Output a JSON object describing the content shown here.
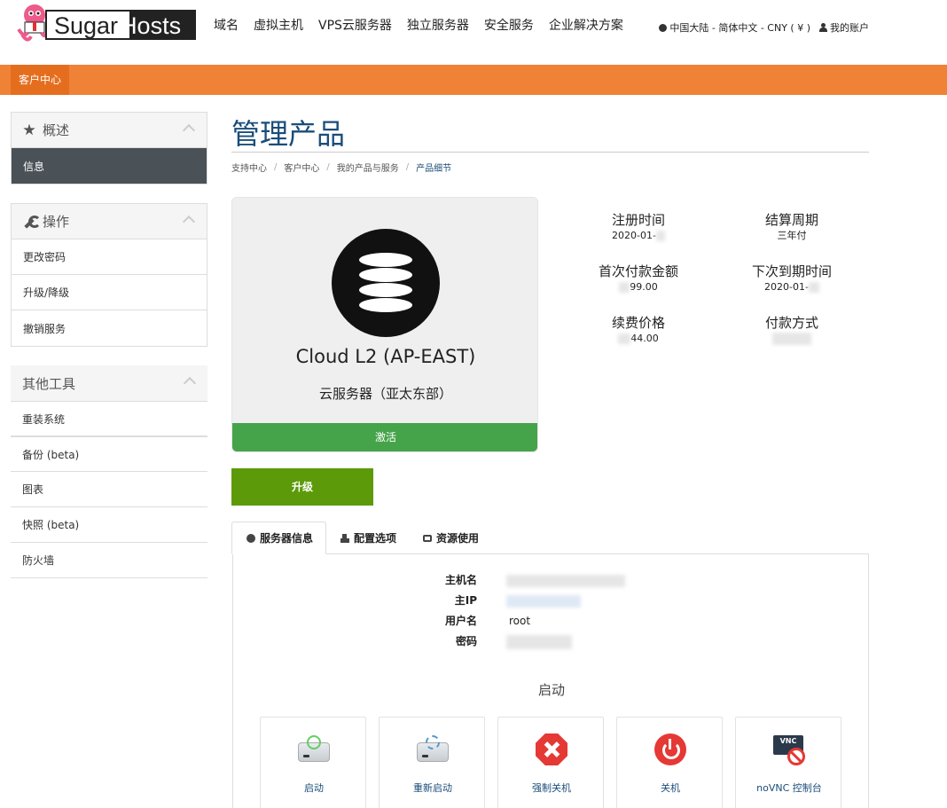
{
  "header": {
    "logo": {
      "sugar": "Sugar",
      "hosts": "Hosts"
    },
    "nav": [
      "域名",
      "虚拟主机",
      "VPS云服务器",
      "独立服务器",
      "安全服务",
      "企业解决方案"
    ],
    "locale": "中国大陆 - 简体中文 - CNY ( ¥ )",
    "account": "我的账户"
  },
  "subnav": {
    "tab": "客户中心"
  },
  "sidebar": {
    "overview": {
      "title": "概述",
      "items": [
        "信息"
      ]
    },
    "actions": {
      "title": "操作",
      "items": [
        "更改密码",
        "升级/降级",
        "撤销服务"
      ]
    },
    "tools": {
      "title": "其他工具",
      "items": [
        "重装系统",
        "备份 (beta)",
        "图表",
        "快照 (beta)",
        "防火墙"
      ]
    }
  },
  "main": {
    "title": "管理产品",
    "breadcrumb": [
      "支持中心",
      "客户中心",
      "我的产品与服务",
      "产品细节"
    ],
    "product": {
      "name": "Cloud L2 (AP-EAST)",
      "sub": "云服务器（亚太东部）",
      "status": "激活"
    },
    "info": {
      "reg_label": "注册时间",
      "reg_value": "2020-01-",
      "cycle_label": "结算周期",
      "cycle_value": "三年付",
      "first_label": "首次付款金额",
      "first_value": "99.00",
      "next_label": "下次到期时间",
      "next_value": "2020-01-",
      "renew_label": "续费价格",
      "renew_value": "44.00",
      "pay_label": "付款方式",
      "pay_value": ""
    },
    "upgrade": "升级",
    "tabs": [
      "服务器信息",
      "配置选项",
      "资源使用"
    ],
    "server": {
      "hostname_label": "主机名",
      "ip_label": "主IP",
      "user_label": "用户名",
      "user_value": "root",
      "password_label": "密码"
    },
    "boot_title": "启动",
    "actions": [
      "启动",
      "重新启动",
      "强制关机",
      "关机",
      "noVNC 控制台"
    ],
    "vnc_badge": "VNC"
  }
}
